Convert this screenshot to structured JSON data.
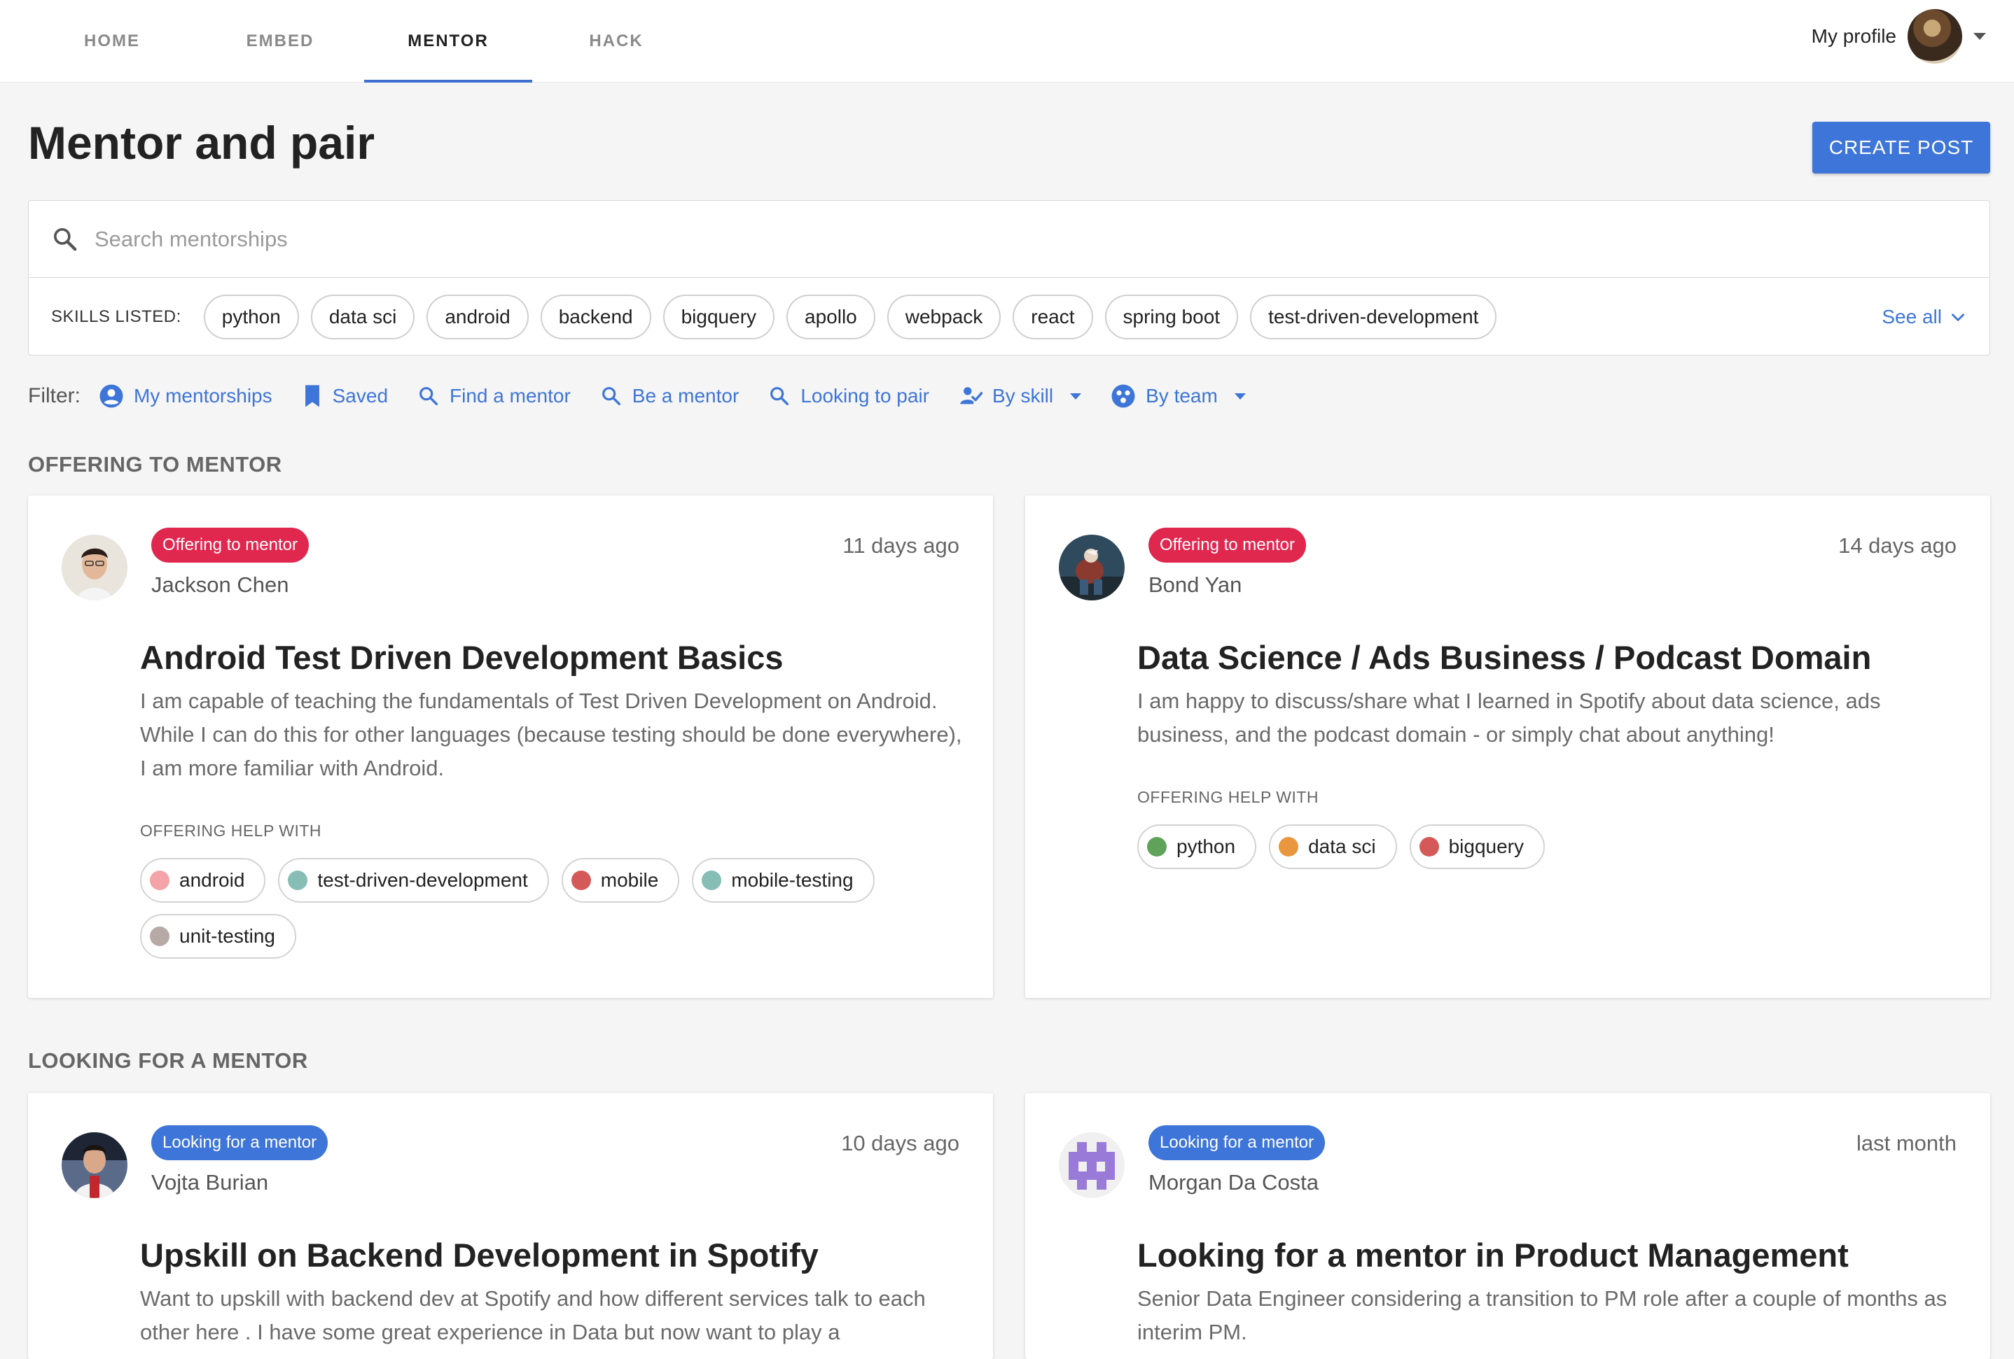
{
  "nav": {
    "tabs": [
      {
        "label": "HOME"
      },
      {
        "label": "EMBED"
      },
      {
        "label": "MENTOR"
      },
      {
        "label": "HACK"
      }
    ],
    "active_tab": "MENTOR",
    "profile_label": "My profile"
  },
  "header": {
    "title": "Mentor and pair",
    "create_label": "CREATE POST"
  },
  "search": {
    "placeholder": "Search mentorships",
    "value": ""
  },
  "skills": {
    "label": "SKILLS LISTED:",
    "items": [
      "python",
      "data sci",
      "android",
      "backend",
      "bigquery",
      "apollo",
      "webpack",
      "react",
      "spring boot",
      "test-driven-development"
    ],
    "see_all": "See all"
  },
  "filter": {
    "label": "Filter:",
    "items": [
      {
        "label": "My mentorships",
        "icon": "account-circle-icon"
      },
      {
        "label": "Saved",
        "icon": "bookmark-icon"
      },
      {
        "label": "Find a mentor",
        "icon": "search-icon"
      },
      {
        "label": "Be a mentor",
        "icon": "search-icon"
      },
      {
        "label": "Looking to pair",
        "icon": "search-icon"
      },
      {
        "label": "By skill",
        "icon": "person-check-icon"
      },
      {
        "label": "By team",
        "icon": "team-icon"
      }
    ]
  },
  "colors": {
    "accent": "#3e75d8",
    "offering_badge": "#e0284f",
    "looking_badge": "#3e75d8"
  },
  "sections": [
    {
      "heading": "OFFERING TO MENTOR",
      "cards": [
        {
          "badge": "Offering to mentor",
          "author": "Jackson Chen",
          "time": "11 days ago",
          "title": "Android Test Driven Development Basics",
          "description": "I am capable of teaching the fundamentals of Test Driven Development on Android. While I can do this for other languages (because testing should be done everywhere), I am more familiar with Android.",
          "help_label": "OFFERING HELP WITH",
          "tags": [
            {
              "label": "android",
              "color": "#f4a3a8"
            },
            {
              "label": "test-driven-development",
              "color": "#86bdb5"
            },
            {
              "label": "mobile",
              "color": "#d45a5a"
            },
            {
              "label": "mobile-testing",
              "color": "#86bdb5"
            },
            {
              "label": "unit-testing",
              "color": "#b5aaa6"
            }
          ]
        },
        {
          "badge": "Offering to mentor",
          "author": "Bond Yan",
          "time": "14 days ago",
          "title": "Data Science / Ads Business / Podcast Domain",
          "description": "I am happy to discuss/share what I learned in Spotify about data science, ads business, and the podcast domain - or simply chat about anything!",
          "help_label": "OFFERING HELP WITH",
          "tags": [
            {
              "label": "python",
              "color": "#5fa35a"
            },
            {
              "label": "data sci",
              "color": "#e8973f"
            },
            {
              "label": "bigquery",
              "color": "#d45a5a"
            }
          ]
        }
      ]
    },
    {
      "heading": "LOOKING FOR A MENTOR",
      "cards": [
        {
          "badge": "Looking for a mentor",
          "author": "Vojta Burian",
          "time": "10 days ago",
          "title": "Upskill on Backend Development in Spotify",
          "description": "Want to upskill with backend dev at Spotify and how different services talk to each other here . I have some great experience in Data but now want to play a"
        },
        {
          "badge": "Looking for a mentor",
          "author": "Morgan Da Costa",
          "time": "last month",
          "title": "Looking for a mentor in Product Management",
          "description": "Senior Data Engineer considering a transition to PM role after a couple of months as interim PM."
        }
      ]
    }
  ]
}
